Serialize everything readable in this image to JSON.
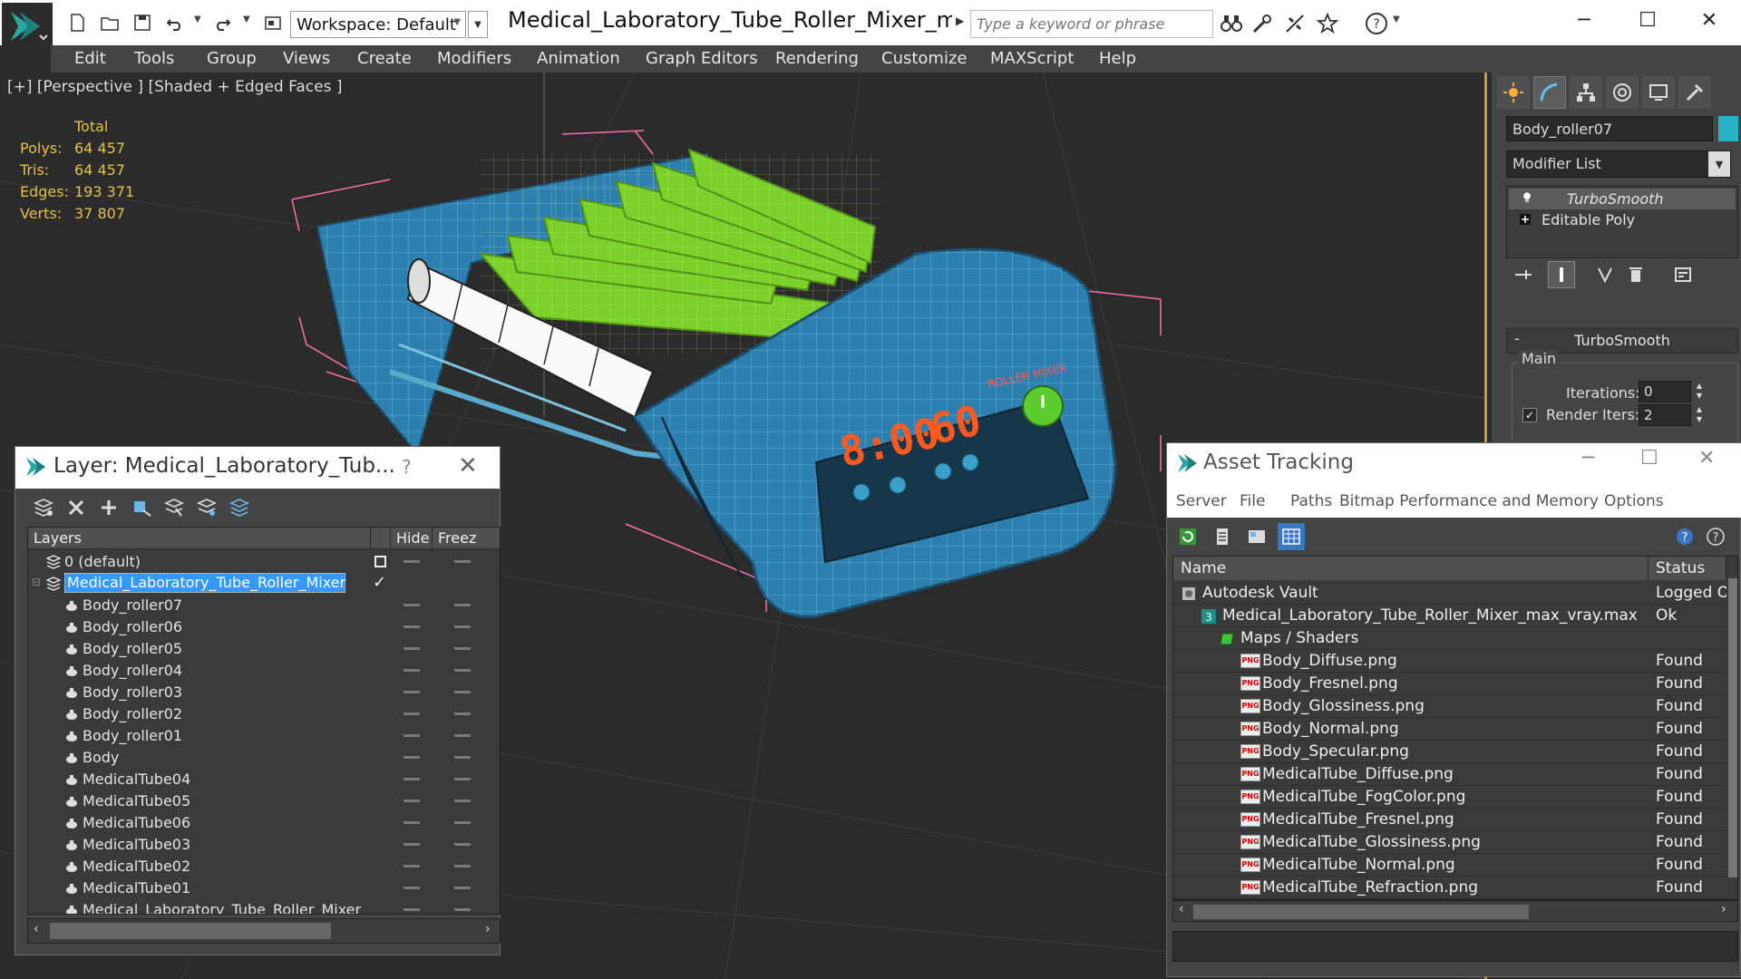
{
  "titlebar": {
    "workspace_label": "Workspace: Default",
    "doc_title": "Medical_Laboratory_Tube_Roller_Mixer_max_...",
    "search_placeholder": "Type a keyword or phrase"
  },
  "menu": [
    "Edit",
    "Tools",
    "Group",
    "Views",
    "Create",
    "Modifiers",
    "Animation",
    "Graph Editors",
    "Rendering",
    "Customize",
    "MAXScript",
    "Help"
  ],
  "viewport": {
    "label": "[+] [Perspective ] [Shaded + Edged Faces ]",
    "stats": {
      "header": "Total",
      "rows": [
        {
          "label": "Polys:",
          "value": "64 457"
        },
        {
          "label": "Tris:",
          "value": "64 457"
        },
        {
          "label": "Edges:",
          "value": "193 371"
        },
        {
          "label": "Verts:",
          "value": "37 807"
        }
      ]
    },
    "display": {
      "time": "8:00",
      "speed": "60",
      "brand": "ROLLER MIXER"
    }
  },
  "command_panel": {
    "object_name": "Body_roller07",
    "object_color": "#2ab2c6",
    "modifier_list": "Modifier List",
    "stack": [
      "TurboSmooth",
      "Editable Poly"
    ],
    "rollout_title": "TurboSmooth",
    "main_group": "Main",
    "iterations_label": "Iterations:",
    "iterations_value": "0",
    "render_iters_label": "Render Iters:",
    "render_iters_value": "2"
  },
  "layer_window": {
    "title": "Layer: Medical_Laboratory_Tub...",
    "help": "?",
    "columns": {
      "layers": "Layers",
      "hide": "Hide",
      "freeze": "Freez"
    },
    "rows": [
      {
        "name": "0 (default)",
        "type": "layer"
      },
      {
        "name": "Medical_Laboratory_Tube_Roller_Mixer",
        "type": "layer-selected"
      },
      {
        "name": "Body_roller07",
        "type": "object"
      },
      {
        "name": "Body_roller06",
        "type": "object"
      },
      {
        "name": "Body_roller05",
        "type": "object"
      },
      {
        "name": "Body_roller04",
        "type": "object"
      },
      {
        "name": "Body_roller03",
        "type": "object"
      },
      {
        "name": "Body_roller02",
        "type": "object"
      },
      {
        "name": "Body_roller01",
        "type": "object"
      },
      {
        "name": "Body",
        "type": "object"
      },
      {
        "name": "MedicalTube04",
        "type": "object"
      },
      {
        "name": "MedicalTube05",
        "type": "object"
      },
      {
        "name": "MedicalTube06",
        "type": "object"
      },
      {
        "name": "MedicalTube03",
        "type": "object"
      },
      {
        "name": "MedicalTube02",
        "type": "object"
      },
      {
        "name": "MedicalTube01",
        "type": "object"
      },
      {
        "name": "Medical_Laboratory_Tube_Roller_Mixer",
        "type": "object"
      }
    ]
  },
  "asset_window": {
    "title": "Asset Tracking",
    "menu": [
      "Server",
      "File",
      "Paths",
      "Bitmap Performance and Memory",
      "Options"
    ],
    "columns": {
      "name": "Name",
      "status": "Status"
    },
    "rows": [
      {
        "name": "Autodesk Vault",
        "status": "Logged Out",
        "level": 0,
        "icon": "vault"
      },
      {
        "name": "Medical_Laboratory_Tube_Roller_Mixer_max_vray.max",
        "status": "Ok",
        "level": 1,
        "icon": "max"
      },
      {
        "name": "Maps / Shaders",
        "status": "",
        "level": 2,
        "icon": "maps"
      },
      {
        "name": "Body_Diffuse.png",
        "status": "Found",
        "level": 3,
        "icon": "png"
      },
      {
        "name": "Body_Fresnel.png",
        "status": "Found",
        "level": 3,
        "icon": "png"
      },
      {
        "name": "Body_Glossiness.png",
        "status": "Found",
        "level": 3,
        "icon": "png"
      },
      {
        "name": "Body_Normal.png",
        "status": "Found",
        "level": 3,
        "icon": "png"
      },
      {
        "name": "Body_Specular.png",
        "status": "Found",
        "level": 3,
        "icon": "png"
      },
      {
        "name": "MedicalTube_Diffuse.png",
        "status": "Found",
        "level": 3,
        "icon": "png"
      },
      {
        "name": "MedicalTube_FogColor.png",
        "status": "Found",
        "level": 3,
        "icon": "png"
      },
      {
        "name": "MedicalTube_Fresnel.png",
        "status": "Found",
        "level": 3,
        "icon": "png"
      },
      {
        "name": "MedicalTube_Glossiness.png",
        "status": "Found",
        "level": 3,
        "icon": "png"
      },
      {
        "name": "MedicalTube_Normal.png",
        "status": "Found",
        "level": 3,
        "icon": "png"
      },
      {
        "name": "MedicalTube_Refraction.png",
        "status": "Found",
        "level": 3,
        "icon": "png"
      }
    ]
  }
}
